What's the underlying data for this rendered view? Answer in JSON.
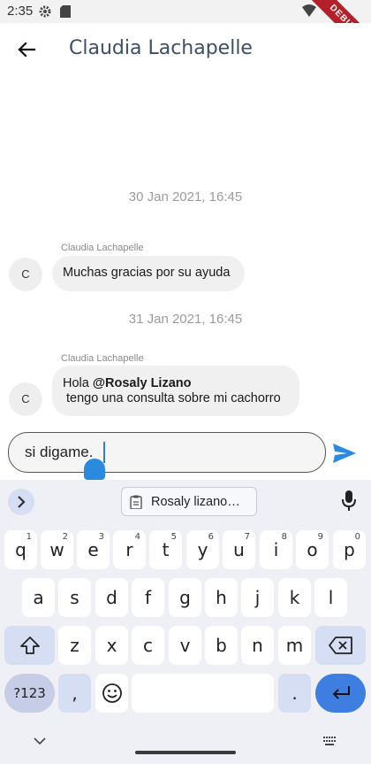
{
  "status_bar": {
    "time": "2:35",
    "debug_label": "DEBUG"
  },
  "app_bar": {
    "title": "Claudia Lachapelle"
  },
  "messages": [
    {
      "date": "30 Jan 2021, 16:45",
      "sender": "Claudia Lachapelle",
      "avatar": "C",
      "line1": "Muchas gracias por su ayuda"
    },
    {
      "date": "31 Jan 2021, 16:45",
      "sender": "Claudia Lachapelle",
      "avatar": "C",
      "line1_prefix": "Hola ",
      "mention": "@Rosaly Lizano",
      "line2": " tengo una consulta sobre mi cachorro"
    }
  ],
  "composer": {
    "value": "si digame."
  },
  "keyboard": {
    "suggestion": "Rosaly lizano…",
    "row1": [
      {
        "k": "q",
        "h": "1"
      },
      {
        "k": "w",
        "h": "2"
      },
      {
        "k": "e",
        "h": "3"
      },
      {
        "k": "r",
        "h": "4"
      },
      {
        "k": "t",
        "h": "5"
      },
      {
        "k": "y",
        "h": "6"
      },
      {
        "k": "u",
        "h": "7"
      },
      {
        "k": "i",
        "h": "8"
      },
      {
        "k": "o",
        "h": "9"
      },
      {
        "k": "p",
        "h": "0"
      }
    ],
    "row2": [
      "a",
      "s",
      "d",
      "f",
      "g",
      "h",
      "j",
      "k",
      "l"
    ],
    "row3": [
      "z",
      "x",
      "c",
      "v",
      "b",
      "n",
      "m"
    ],
    "symbols_label": "?123",
    "comma": ",",
    "period": "."
  },
  "colors": {
    "accent": "#2a8ae0",
    "title": "#3d4f66",
    "enter_key": "#3d7ee0"
  },
  "icons": [
    "gear-icon",
    "sd-card-icon",
    "wifi-icon",
    "battery-icon",
    "back-arrow-icon",
    "send-icon",
    "chevron-right-icon",
    "clipboard-icon",
    "mic-icon",
    "shift-icon",
    "backspace-icon",
    "emoji-icon",
    "enter-icon",
    "chevron-down-icon",
    "keyboard-grid-icon"
  ]
}
